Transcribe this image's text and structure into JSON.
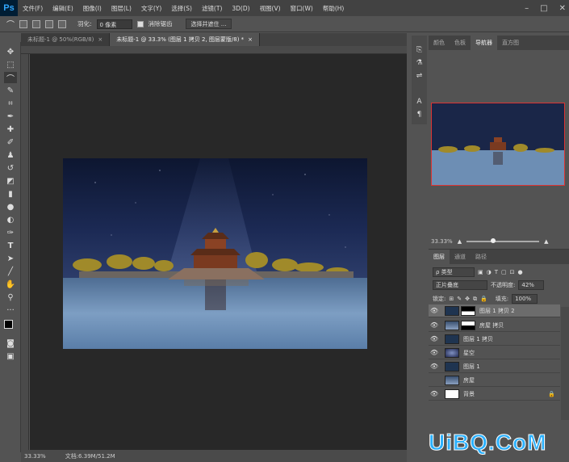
{
  "app": {
    "logo": "Ps"
  },
  "menu": [
    "文件(F)",
    "编辑(E)",
    "图像(I)",
    "图层(L)",
    "文字(Y)",
    "选择(S)",
    "滤镜(T)",
    "3D(D)",
    "视图(V)",
    "窗口(W)",
    "帮助(H)"
  ],
  "window_controls": {
    "minimize": "–",
    "maximize": "□",
    "close": "✕"
  },
  "options": {
    "feather_label": "羽化:",
    "feather_value": "0 像素",
    "antialias_label": "消除锯齿",
    "select_mask_button": "选择并遮住 ..."
  },
  "tabs": [
    {
      "label": "未标题-1 @ 50%(RGB/8)",
      "close": "×"
    },
    {
      "label": "未标题-1 @ 33.3% (图层 1 拷贝 2, 图层蒙版/8) *",
      "close": "×"
    }
  ],
  "status": {
    "zoom": "33.33%",
    "doc": "文档:6.39M/51.2M"
  },
  "nav_panel": {
    "tabs": [
      "颜色",
      "色板",
      "导航器",
      "直方图"
    ],
    "active_tab": "导航器",
    "zoom": "33.33%"
  },
  "layers_panel": {
    "tabs": [
      "图层",
      "通道",
      "路径"
    ],
    "filter_label": "ρ 类型",
    "blend_mode": "正片叠底",
    "opacity_label": "不透明度:",
    "opacity_value": "42%",
    "lock_label": "锁定:",
    "fill_label": "填充:",
    "fill_value": "100%",
    "layers": [
      {
        "name": "图层 1 拷贝 2",
        "selected": true,
        "mask": true,
        "visible": true
      },
      {
        "name": "房屋 拷贝",
        "selected": false,
        "mask": true,
        "visible": true
      },
      {
        "name": "图层 1 拷贝",
        "selected": false,
        "mask": false,
        "visible": true
      },
      {
        "name": "星空",
        "selected": false,
        "mask": false,
        "visible": true
      },
      {
        "name": "图层 1",
        "selected": false,
        "mask": false,
        "visible": true
      },
      {
        "name": "房屋",
        "selected": false,
        "mask": false,
        "visible": false
      },
      {
        "name": "背景",
        "selected": false,
        "mask": false,
        "visible": true
      }
    ]
  },
  "watermark": "UiBQ.CoM",
  "colors": {
    "accent": "#31a8ff",
    "selected_layer": "#6c6c6c",
    "nav_frame": "#dd3333"
  }
}
